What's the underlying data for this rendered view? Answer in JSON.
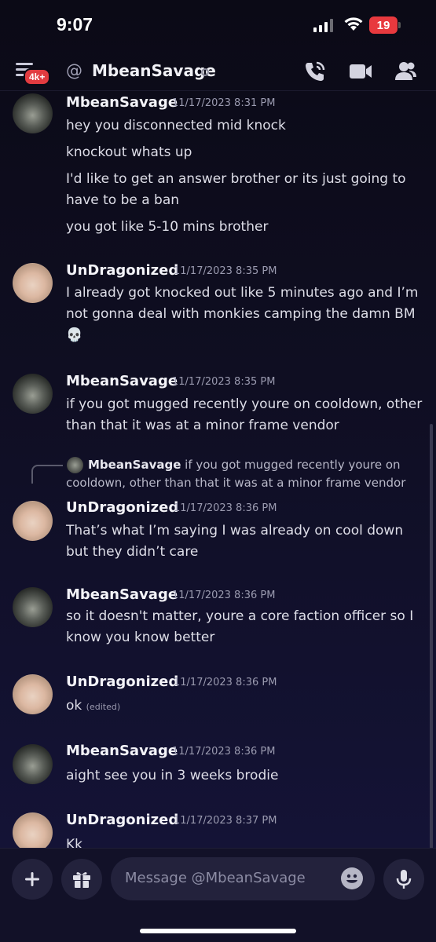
{
  "status_bar": {
    "time": "9:07",
    "battery": "19"
  },
  "header": {
    "badge": "4k+",
    "at_symbol": "@",
    "channel_name": "MbeanSavage",
    "icons": [
      "menu-icon",
      "phone-icon",
      "video-icon",
      "members-icon"
    ]
  },
  "messages": [
    {
      "author": "MbeanSavage",
      "timestamp": "11/17/2023 8:31 PM",
      "lines": [
        "hey you disconnected mid knock",
        "knockout whats up",
        "I'd like to get an answer brother or its just going to have to be a ban",
        "you got like 5-10 mins brother"
      ]
    },
    {
      "author": "UnDragonized",
      "timestamp": "11/17/2023 8:35 PM",
      "lines": [
        "I already got knocked out like 5 minutes ago and I’m not gonna deal with monkies camping the damn BM 💀"
      ]
    },
    {
      "author": "MbeanSavage",
      "timestamp": "11/17/2023 8:35 PM",
      "lines": [
        "if you got mugged recently youre on cooldown, other than that it was at a minor frame vendor"
      ]
    },
    {
      "author": "UnDragonized",
      "timestamp": "11/17/2023 8:36 PM",
      "reply": {
        "author": "MbeanSavage",
        "text": "if you got mugged recently youre on cooldown, other than that it was at a minor frame vendor"
      },
      "lines": [
        "That’s what I’m saying I was already on cool down but they didn’t care"
      ]
    },
    {
      "author": "MbeanSavage",
      "timestamp": "11/17/2023 8:36 PM",
      "lines": [
        "so it doesn't matter, youre a core faction officer so I know you know better"
      ]
    },
    {
      "author": "UnDragonized",
      "timestamp": "11/17/2023 8:36 PM",
      "lines": [
        "ok"
      ],
      "edited": "(edited)"
    },
    {
      "author": "MbeanSavage",
      "timestamp": "11/17/2023 8:36 PM",
      "lines": [
        "aight see you in 3 weeks brodie"
      ]
    },
    {
      "author": "UnDragonized",
      "timestamp": "11/17/2023 8:37 PM",
      "lines": [
        "Kk"
      ]
    }
  ],
  "composer": {
    "placeholder": "Message @MbeanSavage",
    "icons": [
      "plus-icon",
      "gift-icon",
      "emoji-icon",
      "microphone-icon"
    ]
  }
}
